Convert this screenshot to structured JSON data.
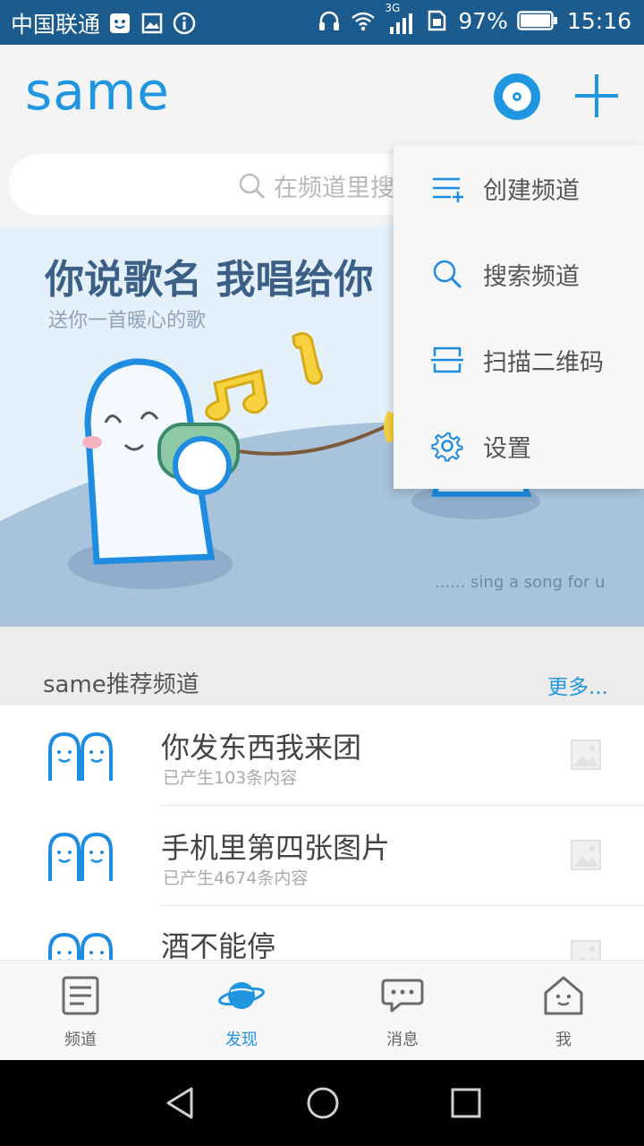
{
  "status_bar": {
    "carrier": "中国联通",
    "network": "3G",
    "battery": "97%",
    "time": "15:16"
  },
  "header": {
    "logo": "same"
  },
  "search": {
    "placeholder": "在频道里搜索"
  },
  "banner": {
    "title": "你说歌名 我唱给你",
    "subtitle": "送你一首暖心的歌",
    "caption": "...... sing a song for u"
  },
  "dropdown_menu": {
    "items": [
      {
        "label": "创建频道",
        "icon": "create-channel-icon"
      },
      {
        "label": "搜索频道",
        "icon": "search-icon"
      },
      {
        "label": "扫描二维码",
        "icon": "scan-qr-icon"
      },
      {
        "label": "设置",
        "icon": "gear-icon"
      }
    ]
  },
  "section": {
    "title": "same推荐频道",
    "more": "更多..."
  },
  "channels": [
    {
      "name": "你发东西我来团",
      "count": "已产生103条内容"
    },
    {
      "name": "手机里第四张图片",
      "count": "已产生4674条内容"
    },
    {
      "name": "酒不能停",
      "count": ""
    }
  ],
  "tabs": [
    {
      "label": "频道",
      "icon": "channel-list-icon",
      "active": false
    },
    {
      "label": "发现",
      "icon": "planet-icon",
      "active": true
    },
    {
      "label": "消息",
      "icon": "chat-bubble-icon",
      "active": false
    },
    {
      "label": "我",
      "icon": "home-face-icon",
      "active": false
    }
  ],
  "colors": {
    "accent": "#2196e0",
    "status_bar": "#1b5b8e",
    "banner_bg": "#e4f1fb"
  }
}
